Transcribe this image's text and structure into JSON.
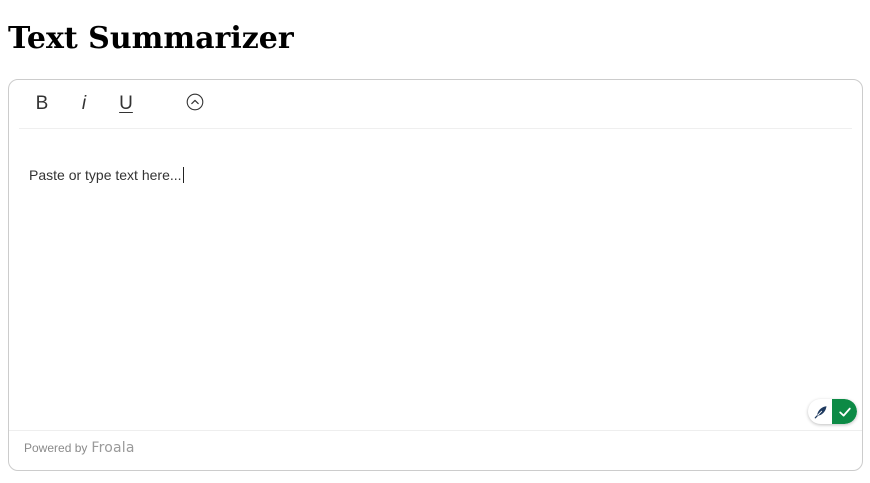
{
  "page": {
    "title": "Text Summarizer"
  },
  "toolbar": {
    "bold_label": "B",
    "italic_label": "i",
    "underline_label": "U",
    "more_icon": "chevron-up-circle-icon"
  },
  "editor": {
    "placeholder": "Paste or type text here...",
    "value": ""
  },
  "grammar_widget": {
    "left_icon": "feather-icon",
    "right_icon": "check-icon",
    "accent_color": "#0c8a45"
  },
  "footer": {
    "powered_by_label": "Powered by",
    "brand": "Froala"
  }
}
